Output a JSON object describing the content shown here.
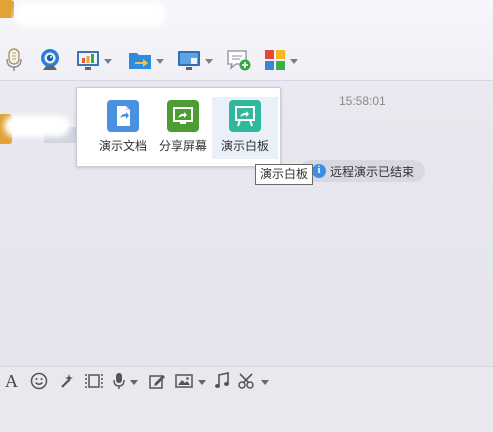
{
  "window": {
    "title": "",
    "toolbar_items": [
      "mic-icon",
      "webcam-icon",
      "present-menu-icon",
      "file-transfer-icon",
      "remote-desktop-icon",
      "add-app-icon",
      "app-grid-icon"
    ]
  },
  "chat": {
    "timestamp": "15:58:01",
    "system_message": "远程演示已结束",
    "info_badge": "i"
  },
  "present_popup": {
    "items": [
      {
        "label": "演示文档",
        "icon": "document-present-icon",
        "color": "#4a90e2"
      },
      {
        "label": "分享屏幕",
        "icon": "share-screen-icon",
        "color": "#4e9d34"
      },
      {
        "label": "演示白板",
        "icon": "whiteboard-icon",
        "color": "#2fb89c"
      }
    ],
    "tooltip": "演示白板"
  },
  "input_toolbar": {
    "font_glyph": "A",
    "items": [
      "font-icon",
      "emoji-icon",
      "magic-icon",
      "screenshot-icon",
      "voice-icon",
      "edit-icon",
      "image-icon",
      "music-icon",
      "scissors-icon"
    ]
  },
  "colors": {
    "accent_blue": "#4a90e2",
    "accent_green": "#4e9d34",
    "accent_teal": "#2fb89c",
    "avatar_orange": "#e1a236"
  }
}
